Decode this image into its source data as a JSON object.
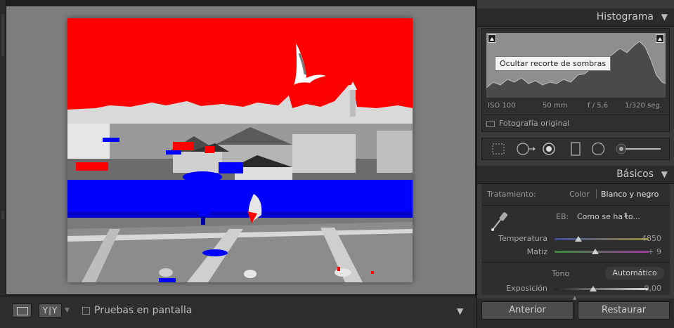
{
  "histogram": {
    "title": "Histograma",
    "tooltip": "Ocultar recorte de sombras",
    "exif": {
      "iso": "ISO 100",
      "focal": "50 mm",
      "aperture": "f / 5,6",
      "shutter": "1/320 seg."
    },
    "original_photo_label": "Fotografía original"
  },
  "basic": {
    "title": "Básicos",
    "treatment_label": "Tratamiento:",
    "treatment_color": "Color",
    "treatment_bw": "Blanco y negro",
    "wb_label": "EB:",
    "wb_value": "Como se ha to...",
    "wb_arrows": "⬍",
    "temperature": {
      "label": "Temperatura",
      "value": "4850",
      "position": 0.25
    },
    "tint": {
      "label": "Matiz",
      "value": "+ 9",
      "position": 0.43
    },
    "tone_label": "Tono",
    "auto_label": "Automático",
    "exposure": {
      "label": "Exposición",
      "value": "0,00",
      "position": 0.41
    }
  },
  "footer": {
    "previous_label": "Anterior",
    "reset_label": "Restaurar"
  },
  "toolbar": {
    "compare_label": "Y|Y",
    "soft_proof_label": "Pruebas en pantalla"
  },
  "icons": [
    "loupe-view-icon",
    "compare-view-icon",
    "dropdown-arrow-icon",
    "panel-collapse-icon",
    "shadow-clip-icon",
    "highlight-clip-icon",
    "crop-icon",
    "spot-removal-icon",
    "red-eye-icon",
    "graduated-filter-icon",
    "radial-filter-icon",
    "adjustment-brush-icon",
    "eyedropper-icon"
  ],
  "colors": {
    "shadow_clip": "#0000ff",
    "highlight_clip": "#ff0000",
    "panel": "#3a3a3a",
    "canvas": "#7d7d7d"
  }
}
